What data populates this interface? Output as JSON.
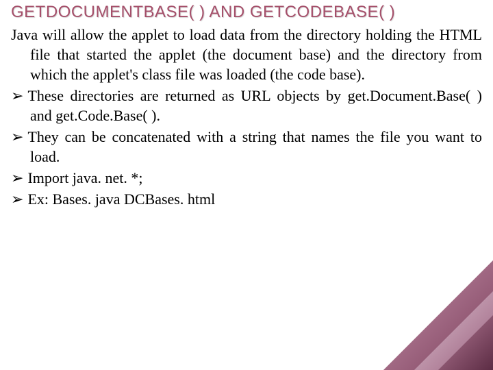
{
  "title": "GETDOCUMENTBASE( ) AND GETCODEBASE( )",
  "paragraph": "Java will allow the applet to load data from the directory holding the HTML file that started the applet (the document base) and the directory from which the applet's class file was loaded (the code base).",
  "bullets": [
    "These directories are returned as URL objects by get.Document.Base( ) and get.Code.Base( ).",
    "They can be concatenated with a string that names the file you want to load.",
    "Import java. net. *;",
    "Ex: Bases. java DCBases. html"
  ],
  "bullet_mark": "➢"
}
